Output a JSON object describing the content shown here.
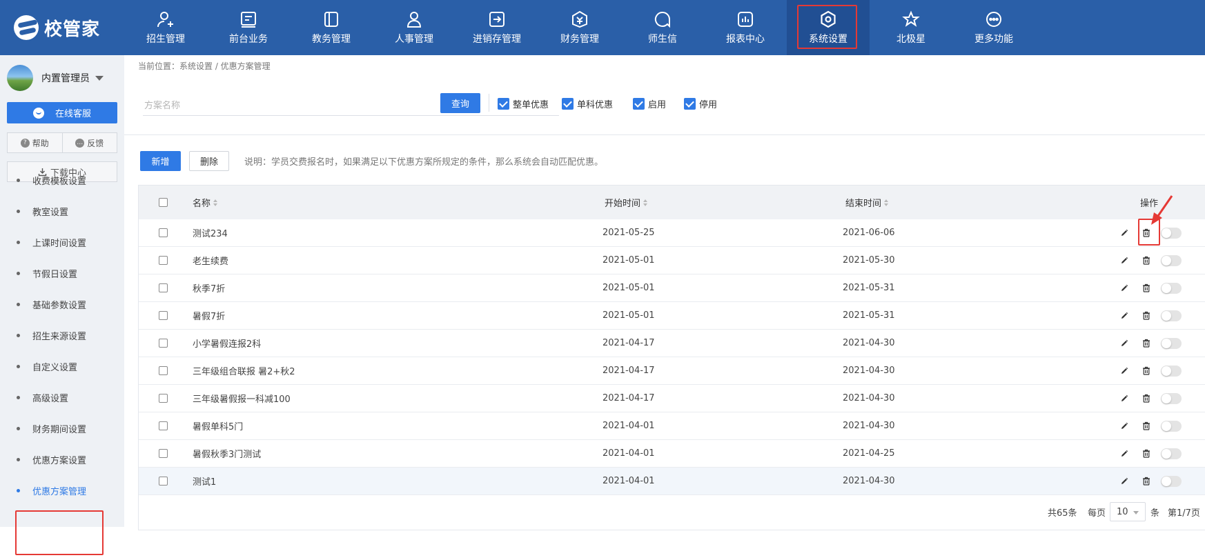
{
  "brand": {
    "name": "校管家"
  },
  "nav": {
    "items": [
      {
        "label": "招生管理",
        "icon": "user-add-icon"
      },
      {
        "label": "前台业务",
        "icon": "monitor-icon"
      },
      {
        "label": "教务管理",
        "icon": "book-icon"
      },
      {
        "label": "人事管理",
        "icon": "person-icon"
      },
      {
        "label": "进销存管理",
        "icon": "inventory-icon"
      },
      {
        "label": "财务管理",
        "icon": "finance-icon"
      },
      {
        "label": "师生信",
        "icon": "message-icon"
      },
      {
        "label": "报表中心",
        "icon": "report-icon"
      },
      {
        "label": "系统设置",
        "icon": "settings-icon",
        "active": true
      },
      {
        "label": "北极星",
        "icon": "star-icon"
      },
      {
        "label": "更多功能",
        "icon": "more-icon"
      }
    ]
  },
  "sidebar": {
    "user_name": "内置管理员",
    "service_label": "在线客服",
    "help_label": "帮助",
    "feedback_label": "反馈",
    "download_label": "下载中心",
    "menu": [
      {
        "label": "收费模板设置"
      },
      {
        "label": "教室设置"
      },
      {
        "label": "上课时间设置"
      },
      {
        "label": "节假日设置"
      },
      {
        "label": "基础参数设置"
      },
      {
        "label": "招生来源设置"
      },
      {
        "label": "自定义设置"
      },
      {
        "label": "高级设置"
      },
      {
        "label": "财务期间设置"
      },
      {
        "label": "优惠方案设置"
      },
      {
        "label": "优惠方案管理",
        "active": true
      }
    ]
  },
  "breadcrumb": "当前位置：系统设置 / 优惠方案管理",
  "filter": {
    "search_placeholder": "方案名称",
    "query_label": "查询",
    "checkboxes": [
      {
        "label": "整单优惠",
        "checked": true
      },
      {
        "label": "单科优惠",
        "checked": true
      },
      {
        "label": "启用",
        "checked": true
      },
      {
        "label": "停用",
        "checked": true
      }
    ]
  },
  "toolbar": {
    "add_label": "新增",
    "delete_label": "删除",
    "note": "说明：学员交费报名时，如果满足以下优惠方案所规定的条件，那么系统会自动匹配优惠。"
  },
  "table": {
    "headers": {
      "name": "名称",
      "start": "开始时间",
      "end": "结束时间",
      "ops": "操作"
    },
    "rows": [
      {
        "name": "测试234",
        "start": "2021-05-25",
        "end": "2021-06-06",
        "enabled": false
      },
      {
        "name": "老生续费",
        "start": "2021-05-01",
        "end": "2021-05-30",
        "enabled": false
      },
      {
        "name": "秋季7折",
        "start": "2021-05-01",
        "end": "2021-05-31",
        "enabled": false
      },
      {
        "name": "暑假7折",
        "start": "2021-05-01",
        "end": "2021-05-31",
        "enabled": false
      },
      {
        "name": "小学暑假连报2科",
        "start": "2021-04-17",
        "end": "2021-04-30",
        "enabled": false
      },
      {
        "name": "三年级组合联报 暑2+秋2",
        "start": "2021-04-17",
        "end": "2021-04-30",
        "enabled": false
      },
      {
        "name": "三年级暑假报一科减100",
        "start": "2021-04-17",
        "end": "2021-04-30",
        "enabled": false
      },
      {
        "name": "暑假单科5门",
        "start": "2021-04-01",
        "end": "2021-04-30",
        "enabled": false
      },
      {
        "name": "暑假秋季3门测试",
        "start": "2021-04-01",
        "end": "2021-04-25",
        "enabled": false
      },
      {
        "name": "测试1",
        "start": "2021-04-01",
        "end": "2021-04-30",
        "enabled": false
      }
    ]
  },
  "pagination": {
    "total": "共65条",
    "per_page_label": "每页",
    "per_page_value": "10",
    "unit": "条",
    "page_info": "第1/7页"
  },
  "colors": {
    "nav_bg": "#2a5fa8",
    "primary": "#2f7ae5",
    "highlight": "#e53935",
    "sidebar_bg": "#eef1f5"
  }
}
